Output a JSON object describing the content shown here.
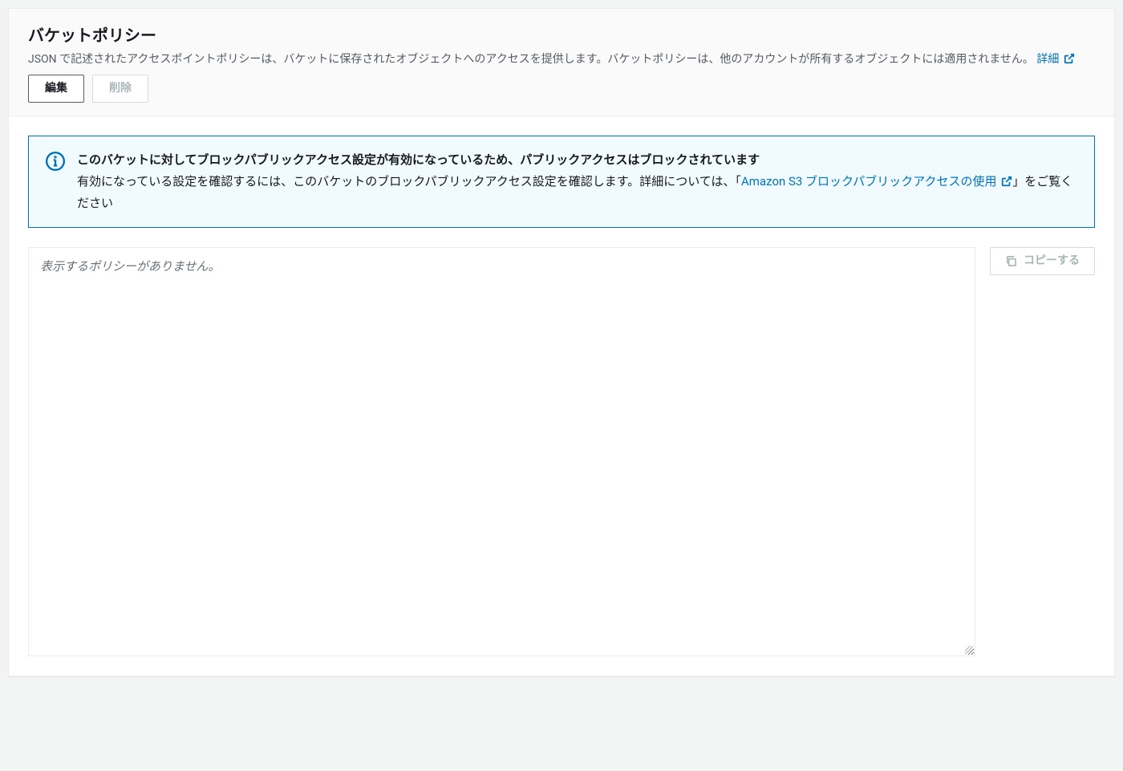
{
  "header": {
    "title": "バケットポリシー",
    "description_prefix": "JSON で記述されたアクセスポイントポリシーは、バケットに保存されたオブジェクトへのアクセスを提供します。バケットポリシーは、他のアカウントが所有するオブジェクトには適用されません。",
    "learn_more_label": "詳細 "
  },
  "buttons": {
    "edit": "編集",
    "delete": "削除",
    "copy": "コピーする"
  },
  "alert": {
    "title": "このバケットに対してブロックパブリックアクセス設定が有効になっているため、パブリックアクセスはブロックされています",
    "text_prefix": "有効になっている設定を確認するには、このバケットのブロックパブリックアクセス設定を確認します。詳細については、「",
    "link_label": "Amazon S3 ブロックパブリックアクセスの使用 ",
    "text_suffix": "」をご覧ください"
  },
  "editor": {
    "placeholder": "表示するポリシーがありません。"
  }
}
